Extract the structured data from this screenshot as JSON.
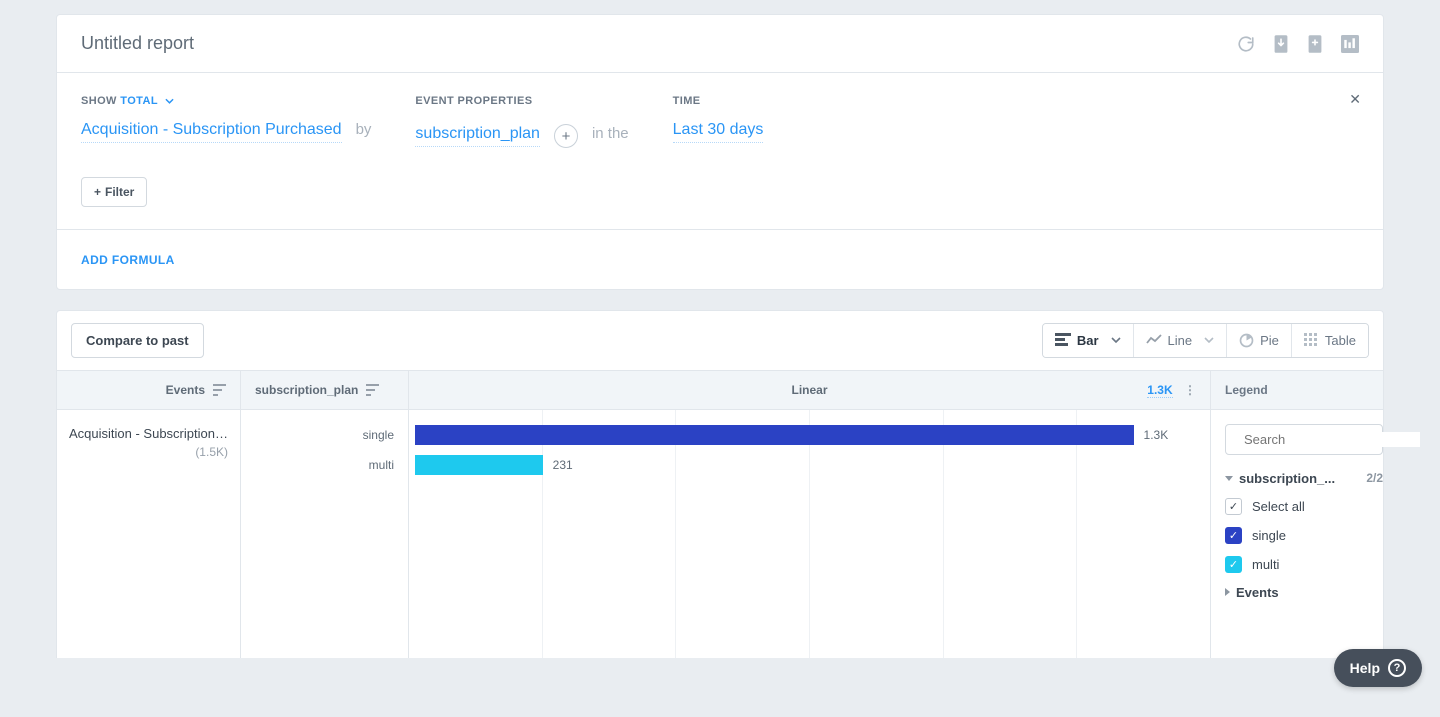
{
  "report": {
    "title": "Untitled report"
  },
  "builder": {
    "show_label_prefix": "SHOW",
    "show_label_value": "TOTAL",
    "event_props_label": "EVENT PROPERTIES",
    "time_label": "TIME",
    "event_name": "Acquisition - Subscription Purchased",
    "by_word": "by",
    "property_name": "subscription_plan",
    "in_the_word": "in the",
    "time_value": "Last 30 days",
    "filter_button": "Filter",
    "add_formula": "ADD FORMULA"
  },
  "toolbar": {
    "compare": "Compare to past",
    "views": {
      "bar": "Bar",
      "line": "Line",
      "pie": "Pie",
      "table": "Table"
    }
  },
  "table_head": {
    "events": "Events",
    "property": "subscription_plan",
    "linear": "Linear",
    "scale_max": "1.3K",
    "legend": "Legend"
  },
  "events_col": {
    "name": "Acquisition - Subscription ...",
    "count": "(1.5K)"
  },
  "chart_data": {
    "type": "bar",
    "orientation": "horizontal",
    "categories": [
      "single",
      "multi"
    ],
    "values": [
      1300,
      231
    ],
    "value_labels": [
      "1.3K",
      "231"
    ],
    "colors": [
      "#2b42c4",
      "#1ec9ee"
    ],
    "title": "",
    "xlabel": "",
    "ylabel": "subscription_plan",
    "xlim": [
      0,
      1300
    ],
    "grid_divisions": 6
  },
  "legend": {
    "search_placeholder": "Search",
    "group_name": "subscription_...",
    "group_count": "2/2",
    "select_all": "Select all",
    "items": [
      {
        "label": "single",
        "color": "blue",
        "checked": true
      },
      {
        "label": "multi",
        "color": "cyan",
        "checked": true
      }
    ],
    "events_group": "Events"
  },
  "help": {
    "label": "Help"
  }
}
